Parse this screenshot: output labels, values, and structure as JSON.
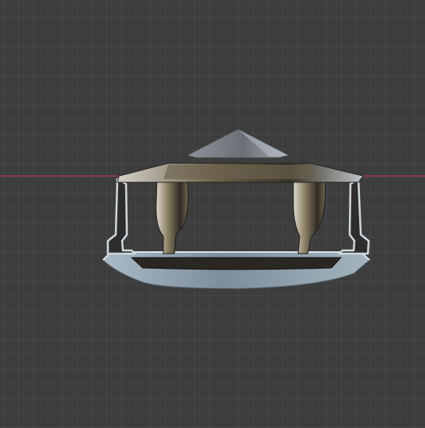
{
  "viewport": {
    "background_color": "#3d3d3d",
    "grid_minor_color": "#474747",
    "grid_major_color": "#525252",
    "x_axis_color": "#b3404f",
    "model": {
      "name_hint": "gazebo-model",
      "colors": {
        "roof": "#7d8288",
        "roof_light": "#a9b0b6",
        "dark": "#262626",
        "metal": "#8a97a3",
        "metal_light": "#c7d2da",
        "base": "#8b9ba8",
        "base_dark": "#5c6872",
        "gold": "#b9a27d"
      }
    }
  }
}
